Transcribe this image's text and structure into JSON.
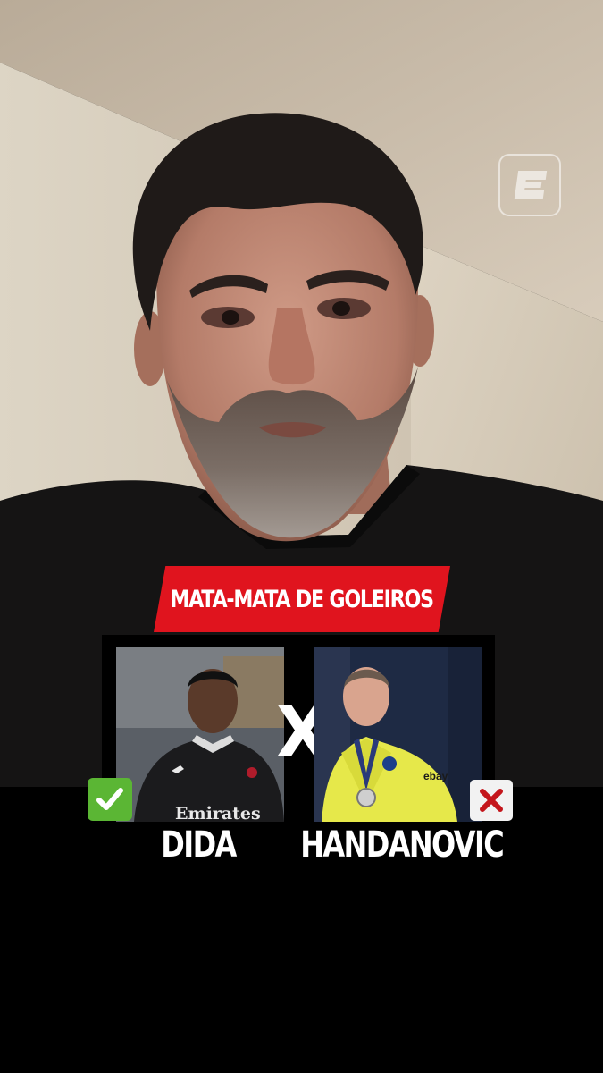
{
  "brand": {
    "logo_icon": "espn-e-logo-icon"
  },
  "banner": {
    "title": "MATA-MATA DE GOLEIROS",
    "color": "#e0141e"
  },
  "matchup": {
    "separator": "X",
    "left_player": {
      "name": "DIDA",
      "result_icon": "check-mark-icon",
      "result_color": "#5bb634",
      "shirt_sponsor": "Emirates"
    },
    "right_player": {
      "name": "HANDANOVIC",
      "result_icon": "cross-mark-icon",
      "result_color": "#c4161c",
      "shirt_sponsor": "ebay"
    }
  }
}
